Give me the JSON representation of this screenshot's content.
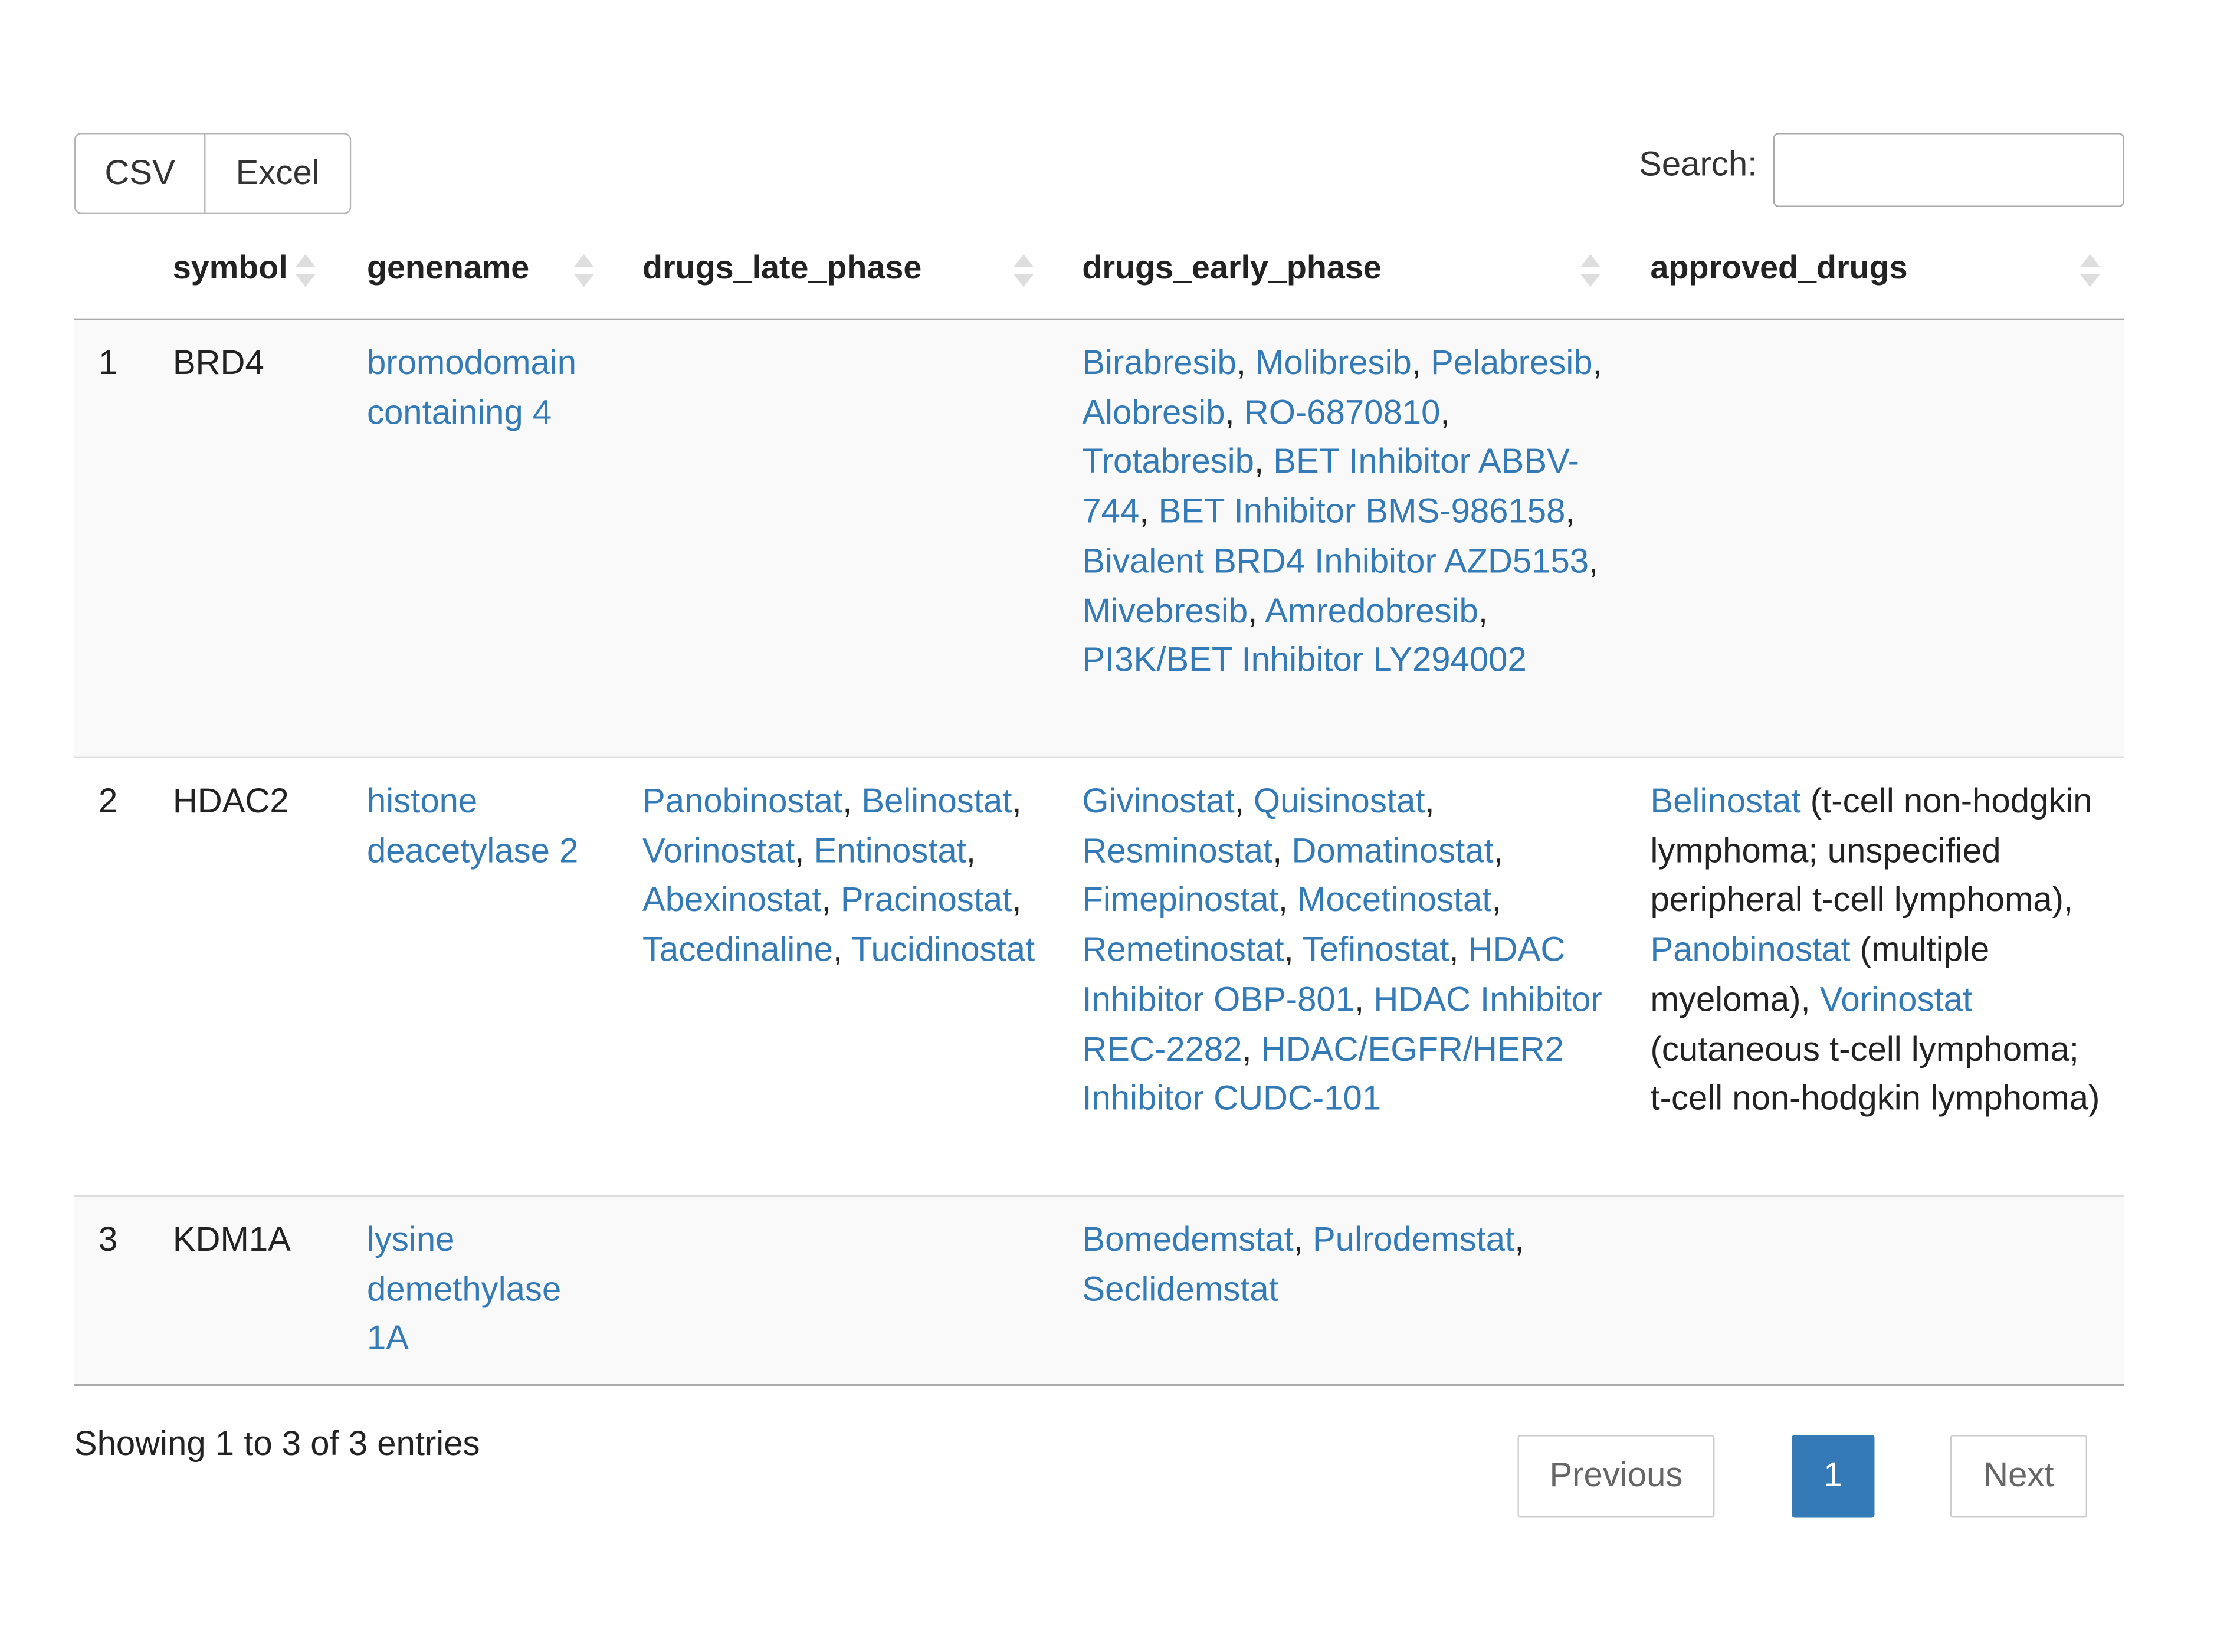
{
  "toolbar": {
    "buttons": [
      "CSV",
      "Excel"
    ],
    "search_label": "Search:",
    "search_value": ""
  },
  "table": {
    "columns": [
      "",
      "symbol",
      "genename",
      "drugs_late_phase",
      "drugs_early_phase",
      "approved_drugs"
    ],
    "rows": [
      {
        "index": "1",
        "symbol": "BRD4",
        "genename": "bromodomain containing 4",
        "drugs_late_phase": [],
        "drugs_early_phase": [
          "Birabresib",
          "Molibresib",
          "Pelabresib",
          "Alobresib",
          "RO-6870810",
          "Trotabresib",
          "BET Inhibitor ABBV-744",
          "BET Inhibitor BMS-986158",
          "Bivalent BRD4 Inhibitor AZD5153",
          "Mivebresib",
          "Amredobresib",
          "PI3K/BET Inhibitor LY294002"
        ],
        "approved_drugs": []
      },
      {
        "index": "2",
        "symbol": "HDAC2",
        "genename": "histone deacetylase 2",
        "drugs_late_phase": [
          "Panobinostat",
          "Belinostat",
          "Vorinostat",
          "Entinostat",
          "Abexinostat",
          "Pracinostat",
          "Tacedinaline",
          "Tucidinostat"
        ],
        "drugs_early_phase": [
          "Givinostat",
          "Quisinostat",
          "Resminostat",
          "Domatinostat",
          "Fimepinostat",
          "Mocetinostat",
          "Remetinostat",
          "Tefinostat",
          "HDAC Inhibitor OBP-801",
          "HDAC Inhibitor REC-2282",
          "HDAC/EGFR/HER2 Inhibitor CUDC-101"
        ],
        "approved_drugs": [
          {
            "name": "Belinostat",
            "indication": "(t-cell non-hodgkin lymphoma; unspecified peripheral t-cell lymphoma)"
          },
          {
            "name": "Panobinostat",
            "indication": "(multiple myeloma)"
          },
          {
            "name": "Vorinostat",
            "indication": "(cutaneous t-cell lymphoma; t-cell non-hodgkin lymphoma)"
          }
        ]
      },
      {
        "index": "3",
        "symbol": "KDM1A",
        "genename": "lysine demethylase 1A",
        "drugs_late_phase": [],
        "drugs_early_phase": [
          "Bomedemstat",
          "Pulrodemstat",
          "Seclidemstat"
        ],
        "approved_drugs": []
      }
    ]
  },
  "footer": {
    "info": "Showing 1 to 3 of 3 entries",
    "previous_label": "Previous",
    "current_page": "1",
    "next_label": "Next"
  },
  "colors": {
    "link": "#337ab7",
    "row_background": "#f9f9f9",
    "active_page": "#337ab7"
  }
}
